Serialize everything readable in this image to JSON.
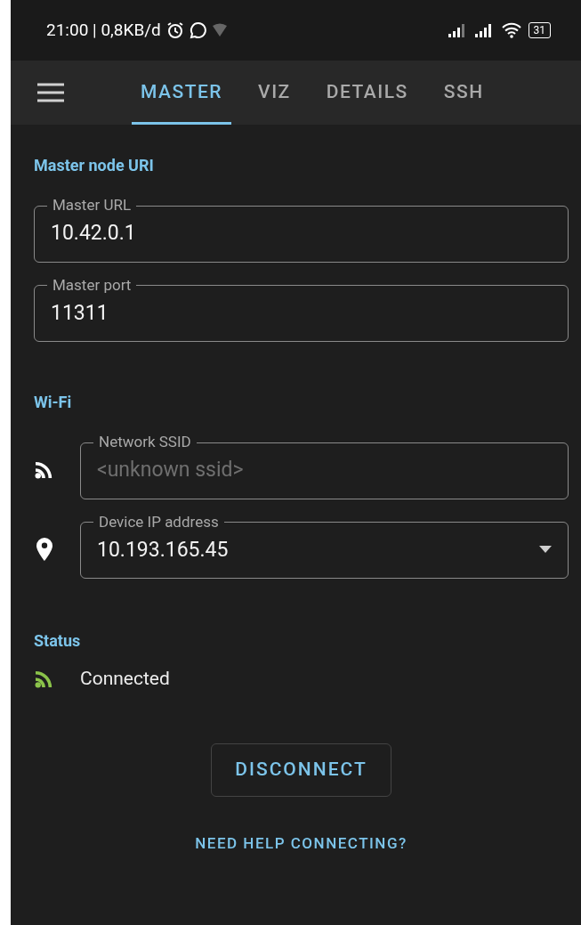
{
  "status_bar": {
    "time": "21:00 | 0,8KB/d",
    "battery": "31"
  },
  "tabs": [
    {
      "label": "MASTER",
      "selected": true
    },
    {
      "label": "VIZ",
      "selected": false
    },
    {
      "label": "DETAILS",
      "selected": false
    },
    {
      "label": "SSH",
      "selected": false
    }
  ],
  "master": {
    "title": "Master node URI",
    "fields": [
      {
        "label": "Master URL",
        "value": "10.42.0.1"
      },
      {
        "label": "Master port",
        "value": "11311"
      }
    ]
  },
  "wifi": {
    "title": "Wi-Fi",
    "fields": [
      {
        "kind": "text",
        "label": "Network SSID",
        "placeholder": "<unknown ssid>"
      },
      {
        "kind": "dropdown",
        "label": "Device IP address",
        "value": "10.193.165.45"
      }
    ]
  },
  "status": {
    "title": "Status",
    "label": "Connected",
    "connected": true
  },
  "buttons": {
    "primary": "DISCONNECT",
    "link": "NEED HELP CONNECTING?"
  }
}
